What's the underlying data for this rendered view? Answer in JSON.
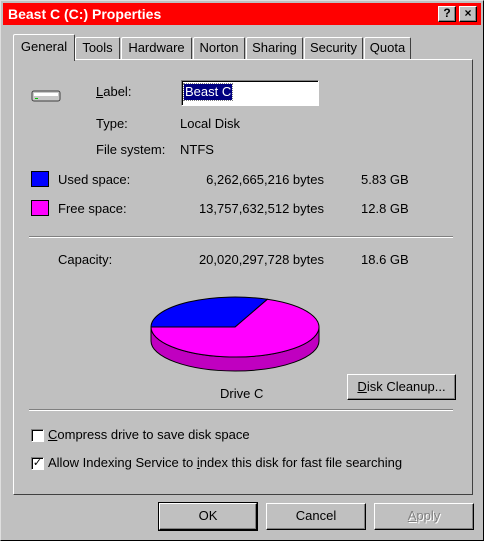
{
  "window": {
    "title": "Beast C (C:) Properties",
    "help_label": "?",
    "close_label": "×"
  },
  "tabs": [
    {
      "label": "General",
      "active": true
    },
    {
      "label": "Tools"
    },
    {
      "label": "Hardware"
    },
    {
      "label": "Norton"
    },
    {
      "label": "Sharing"
    },
    {
      "label": "Security"
    },
    {
      "label": "Quota"
    }
  ],
  "general": {
    "label_caption": "Label:",
    "label_value": "Beast C",
    "type_caption": "Type:",
    "type_value": "Local Disk",
    "fs_caption": "File system:",
    "fs_value": "NTFS",
    "used_caption": "Used space:",
    "used_bytes": "6,262,665,216 bytes",
    "used_gb": "5.83 GB",
    "free_caption": "Free space:",
    "free_bytes": "13,757,632,512 bytes",
    "free_gb": "12.8 GB",
    "capacity_caption": "Capacity:",
    "capacity_bytes": "20,020,297,728 bytes",
    "capacity_gb": "18.6 GB",
    "drive_caption": "Drive C",
    "cleanup_label": "Disk Cleanup...",
    "compress_label": "Compress drive to save disk space",
    "compress_checked": false,
    "index_label": "Allow Indexing Service to index this disk for fast file searching",
    "index_checked": true,
    "used_color": "#0000ff",
    "free_color": "#ff00ff",
    "used_fraction": 0.3128
  },
  "buttons": {
    "ok": "OK",
    "cancel": "Cancel",
    "apply": "Apply"
  },
  "title_color": "#ff0000",
  "icons": {
    "drive": "hard-drive-icon"
  }
}
